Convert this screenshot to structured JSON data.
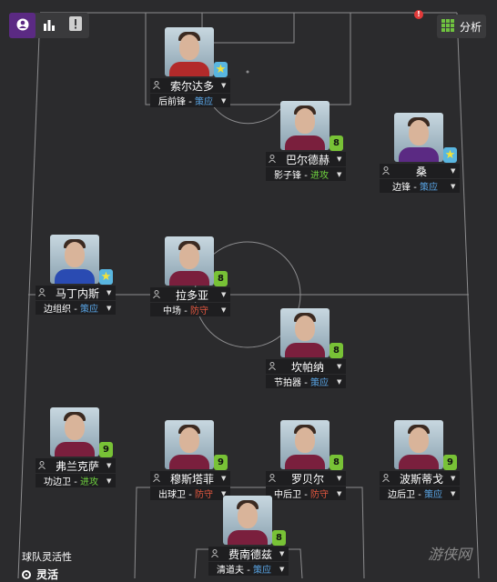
{
  "header": {
    "analysis_label": "分析",
    "notification_mark": "!"
  },
  "players": [
    {
      "id": "sol",
      "name": "索尔达多",
      "role": "后前锋",
      "duty": "策应",
      "duty_type": "support",
      "badge": "star",
      "badge_value": "★",
      "jersey": "#b22a2a"
    },
    {
      "id": "bar",
      "name": "巴尔德赫",
      "role": "影子锋",
      "duty": "进攻",
      "duty_type": "attack",
      "badge": "num",
      "badge_value": "8",
      "jersey": "#7a1f3d"
    },
    {
      "id": "san",
      "name": "桑",
      "role": "边锋",
      "duty": "策应",
      "duty_type": "support",
      "badge": "star",
      "badge_value": "★",
      "jersey": "#5b2a83"
    },
    {
      "id": "mar",
      "name": "马丁内斯",
      "role": "边组织",
      "duty": "策应",
      "duty_type": "support",
      "badge": "star",
      "badge_value": "★",
      "jersey": "#2a4bb2"
    },
    {
      "id": "lad",
      "name": "拉多亚",
      "role": "中场",
      "duty": "防守",
      "duty_type": "defend",
      "badge": "num",
      "badge_value": "8",
      "jersey": "#7a1f3d"
    },
    {
      "id": "kam",
      "name": "坎帕纳",
      "role": "节拍器",
      "duty": "策应",
      "duty_type": "support",
      "badge": "num",
      "badge_value": "8",
      "jersey": "#7a1f3d"
    },
    {
      "id": "fra",
      "name": "弗兰克萨",
      "role": "功边卫",
      "duty": "进攻",
      "duty_type": "attack",
      "badge": "num",
      "badge_value": "9",
      "jersey": "#7a1f3d"
    },
    {
      "id": "mus",
      "name": "穆斯塔菲",
      "role": "出球卫",
      "duty": "防守",
      "duty_type": "defend",
      "badge": "num",
      "badge_value": "9",
      "jersey": "#7a1f3d"
    },
    {
      "id": "luo",
      "name": "罗贝尔",
      "role": "中后卫",
      "duty": "防守",
      "duty_type": "defend",
      "badge": "num",
      "badge_value": "8",
      "jersey": "#7a1f3d"
    },
    {
      "id": "bos",
      "name": "波斯蒂戈",
      "role": "边后卫",
      "duty": "策应",
      "duty_type": "support",
      "badge": "num",
      "badge_value": "9",
      "jersey": "#7a1f3d"
    },
    {
      "id": "fer",
      "name": "费南德兹",
      "role": "清道夫",
      "duty": "策应",
      "duty_type": "support",
      "badge": "num",
      "badge_value": "8",
      "jersey": "#7a1f3d"
    }
  ],
  "team_flexibility": {
    "label": "球队灵活性",
    "value": "灵活"
  },
  "watermark": "游侠网",
  "colors": {
    "background": "#2b2b2d",
    "accent_purple": "#5b2a83",
    "support": "#5aa7e8",
    "attack": "#6fd23f",
    "defend": "#e4573f",
    "rating_badge": "#78c236"
  }
}
